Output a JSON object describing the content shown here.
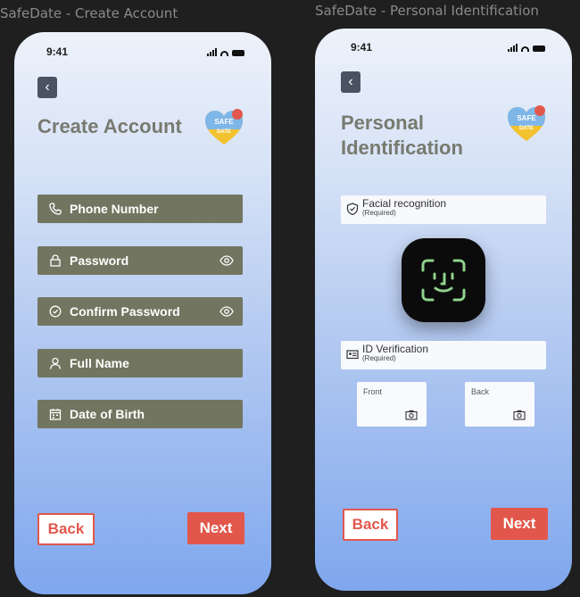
{
  "frames": {
    "create": {
      "label": "SafeDate - Create Account"
    },
    "personal": {
      "label": "SafeDate - Personal Identification"
    }
  },
  "status": {
    "time": "9:41"
  },
  "logo": {
    "line1": "SAFE",
    "line2": "DATE",
    "colors": {
      "heart_top": "#7fb6e8",
      "heart_bottom": "#f2c230",
      "badge": "#e2574c"
    }
  },
  "create_account": {
    "title": "Create Account",
    "fields": [
      {
        "label": "Phone Number",
        "icon": "phone-icon"
      },
      {
        "label": "Password",
        "icon": "lock-icon",
        "toggle": "eye-icon"
      },
      {
        "label": "Confirm Password",
        "icon": "shield-check-icon",
        "toggle": "eye-icon"
      },
      {
        "label": "Full Name",
        "icon": "person-icon"
      },
      {
        "label": "Date of Birth",
        "icon": "calendar-icon"
      }
    ],
    "back_label": "Back",
    "next_label": "Next"
  },
  "personal_id": {
    "title_line1": "Personal",
    "title_line2": "Identification",
    "facial": {
      "label": "Facial recognition",
      "required": "(Required)",
      "icon": "shield-icon"
    },
    "face_id_icon": "face-id-icon",
    "id_verification": {
      "label": "ID Verification",
      "required": "(Required)",
      "icon": "id-card-icon"
    },
    "front_label": "Front",
    "back_card_label": "Back",
    "back_label": "Back",
    "next_label": "Next"
  },
  "colors": {
    "field_bg": "#727560",
    "accent": "#e2574c",
    "title": "#777a6f"
  }
}
